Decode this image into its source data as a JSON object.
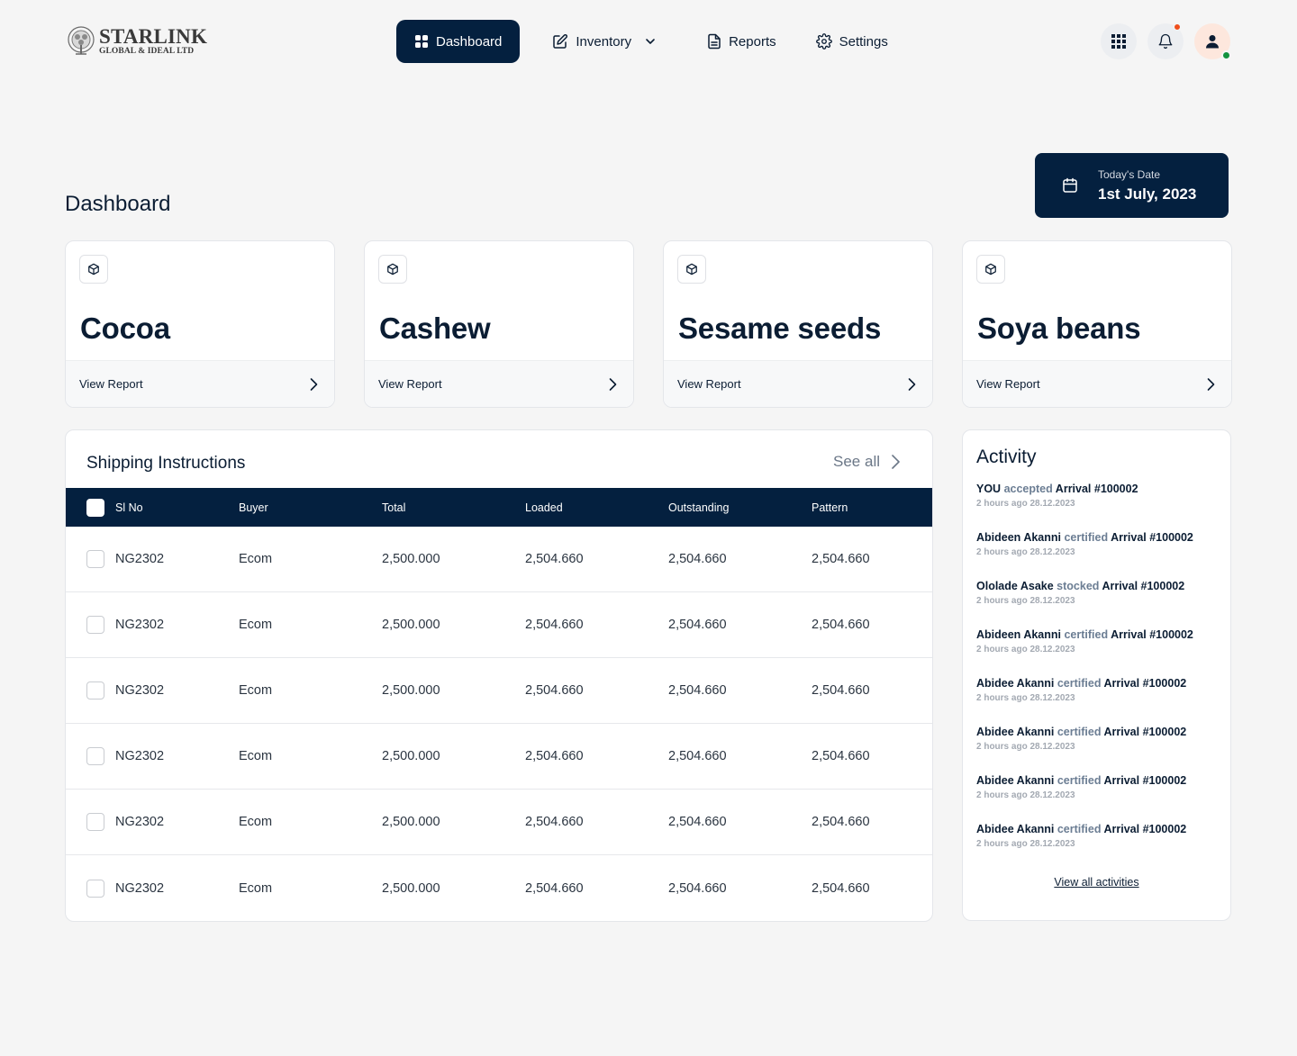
{
  "brand": {
    "name": "STARLINK",
    "subtitle": "GLOBAL & IDEAL LTD"
  },
  "nav": {
    "items": [
      {
        "label": "Dashboard",
        "icon": "grid-icon",
        "active": true
      },
      {
        "label": "Inventory",
        "icon": "edit-icon",
        "has_dropdown": true
      },
      {
        "label": "Reports",
        "icon": "document-icon"
      },
      {
        "label": "Settings",
        "icon": "gear-icon"
      }
    ]
  },
  "header_actions": {
    "apps": "apps-grid-icon",
    "notifications": "bell-icon",
    "profile": "user-icon"
  },
  "page": {
    "title": "Dashboard"
  },
  "date_card": {
    "label": "Today's Date",
    "value": "1st July, 2023"
  },
  "commodities": [
    {
      "name": "Cocoa",
      "link": "View Report"
    },
    {
      "name": "Cashew",
      "link": "View Report"
    },
    {
      "name": "Sesame seeds",
      "link": "View Report"
    },
    {
      "name": "Soya beans",
      "link": "View Report"
    }
  ],
  "shipping": {
    "title": "Shipping Instructions",
    "see_all": "See all",
    "columns": [
      "Sl No",
      "Buyer",
      "Total",
      "Loaded",
      "Outstanding",
      "Pattern"
    ],
    "rows": [
      [
        "NG2302",
        "Ecom",
        "2,500.000",
        "2,504.660",
        "2,504.660",
        "2,504.660"
      ],
      [
        "NG2302",
        "Ecom",
        "2,500.000",
        "2,504.660",
        "2,504.660",
        "2,504.660"
      ],
      [
        "NG2302",
        "Ecom",
        "2,500.000",
        "2,504.660",
        "2,504.660",
        "2,504.660"
      ],
      [
        "NG2302",
        "Ecom",
        "2,500.000",
        "2,504.660",
        "2,504.660",
        "2,504.660"
      ],
      [
        "NG2302",
        "Ecom",
        "2,500.000",
        "2,504.660",
        "2,504.660",
        "2,504.660"
      ],
      [
        "NG2302",
        "Ecom",
        "2,500.000",
        "2,504.660",
        "2,504.660",
        "2,504.660"
      ]
    ]
  },
  "activity": {
    "title": "Activity",
    "items": [
      {
        "actor": "YOU",
        "verb": "accepted",
        "object": "Arrival #100002",
        "time": "2 hours ago 28.12.2023"
      },
      {
        "actor": "Abideen Akanni",
        "verb": "certified",
        "object": "Arrival #100002",
        "time": "2 hours ago 28.12.2023"
      },
      {
        "actor": "Ololade Asake",
        "verb": "stocked",
        "object": "Arrival #100002",
        "time": "2 hours ago 28.12.2023"
      },
      {
        "actor": "Abideen Akanni",
        "verb": "certified",
        "object": "Arrival #100002",
        "time": "2 hours ago 28.12.2023"
      },
      {
        "actor": "Abidee Akanni",
        "verb": "certified",
        "object": "Arrival #100002",
        "time": "2 hours ago 28.12.2023"
      },
      {
        "actor": "Abidee Akanni",
        "verb": "certified",
        "object": "Arrival #100002",
        "time": "2 hours ago 28.12.2023"
      },
      {
        "actor": "Abidee Akanni",
        "verb": "certified",
        "object": "Arrival #100002",
        "time": "2 hours ago 28.12.2023"
      },
      {
        "actor": "Abidee Akanni",
        "verb": "certified",
        "object": "Arrival #100002",
        "time": "2 hours ago 28.12.2023"
      }
    ],
    "view_all": "View all activities"
  }
}
